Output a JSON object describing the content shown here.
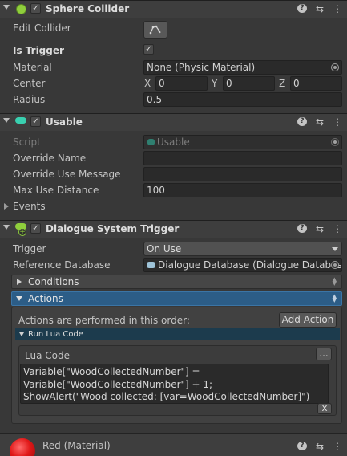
{
  "sphere_collider": {
    "title": "Sphere Collider",
    "edit_collider_label": "Edit Collider",
    "is_trigger_label": "Is Trigger",
    "material_label": "Material",
    "material_value": "None (Physic Material)",
    "center_label": "Center",
    "center": [
      {
        "axis": "X",
        "value": "0"
      },
      {
        "axis": "Y",
        "value": "0"
      },
      {
        "axis": "Z",
        "value": "0"
      }
    ],
    "radius_label": "Radius",
    "radius_value": "0.5"
  },
  "usable": {
    "title": "Usable",
    "script_label": "Script",
    "script_value": "Usable",
    "override_name_label": "Override Name",
    "override_name_value": "",
    "override_use_message_label": "Override Use Message",
    "override_use_message_value": "",
    "max_use_distance_label": "Max Use Distance",
    "max_use_distance_value": "100",
    "events_label": "Events"
  },
  "dialogue_trigger": {
    "title": "Dialogue System Trigger",
    "trigger_label": "Trigger",
    "trigger_value": "On Use",
    "reference_db_label": "Reference Database",
    "reference_db_value": "Dialogue Database (Dialogue Databas",
    "conditions_label": "Conditions",
    "actions_label": "Actions",
    "actions_order_text": "Actions are performed in this order:",
    "add_action_label": "Add Action",
    "run_lua_label": "Run Lua Code",
    "lua_code_label": "Lua Code",
    "lua_dots_label": "...",
    "lua_code_text": "Variable[\"WoodCollectedNumber\"] =\nVariable[\"WoodCollectedNumber\"] + 1;\nShowAlert(\"Wood collected: [var=WoodCollectedNumber]\")",
    "remove_label": "x"
  },
  "material": {
    "title": "Red (Material)"
  },
  "header_icons": {
    "help": "?",
    "presets": "⇆",
    "menu": "⋮"
  },
  "colors": {
    "sphere_icon": "#8fce3c",
    "usable_icon": "#39d0b0",
    "actions_accent": "#2c5d87",
    "material_sphere": "#e01818"
  }
}
